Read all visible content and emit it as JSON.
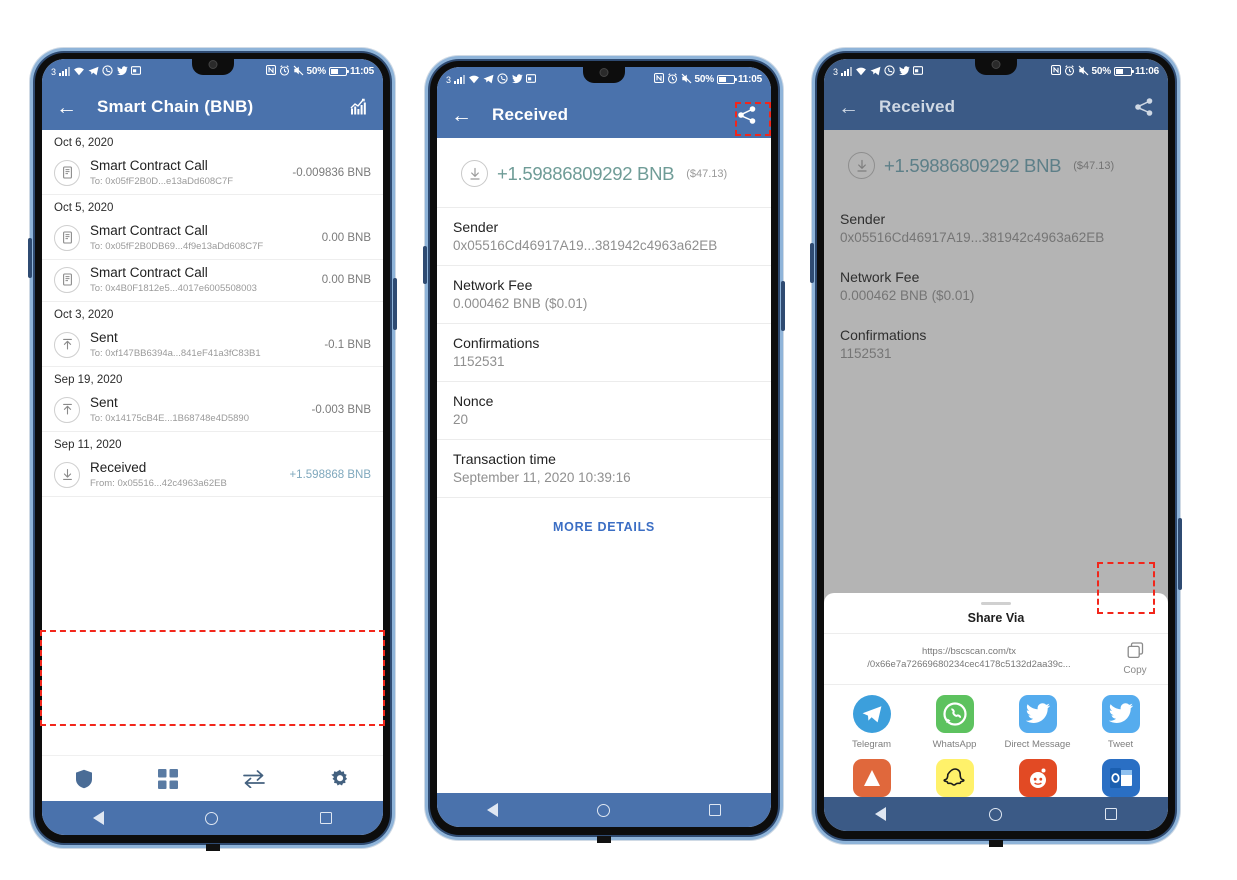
{
  "meta": {
    "phone1_label": "transaction-history-screen",
    "phone2_label": "transaction-detail-screen",
    "phone3_label": "share-sheet-screen"
  },
  "colors": {
    "app_bar_blue": "#4a72ac",
    "app_bar_blue_dim": "#3b5a86",
    "accent_link": "#3b6ec4",
    "amount_green": "#6f9c97",
    "amount_blue_grey": "#7fa8bd",
    "highlight_red": "#f2261b",
    "telegram": "#3c9fdc",
    "whatsapp": "#5dc25f",
    "twitter": "#55acee"
  },
  "status_bar": {
    "left_number": "3",
    "left_icons": [
      "signal-bars-icon",
      "wifi-icon",
      "telegram-icon",
      "whatsapp-icon",
      "twitter-icon",
      "mail-icon"
    ],
    "right_icons": [
      "nfc-icon",
      "alarm-icon",
      "mute-icon"
    ],
    "battery_percent": "50%",
    "time_phone1": "11:05",
    "time_phone2": "11:05",
    "time_phone3": "11:06"
  },
  "phone1": {
    "app_bar": {
      "back_icon": "arrow-left-icon",
      "title": "Smart Chain (BNB)",
      "right_icon": "chart-icon"
    },
    "groups": [
      {
        "date": "Oct 6, 2020",
        "items": [
          {
            "icon": "contract-icon",
            "title": "Smart Contract Call",
            "sub": "To: 0x05fF2B0D...e13aDd608C7F",
            "amount": "-0.009836 BNB",
            "positive": false
          }
        ]
      },
      {
        "date": "Oct 5, 2020",
        "items": [
          {
            "icon": "contract-icon",
            "title": "Smart Contract Call",
            "sub": "To: 0x05fF2B0DB69...4f9e13aDd608C7F",
            "amount": "0.00 BNB",
            "positive": false
          },
          {
            "icon": "contract-icon",
            "title": "Smart Contract Call",
            "sub": "To: 0x4B0F1812e5...4017e6005508003",
            "amount": "0.00 BNB",
            "positive": false
          }
        ]
      },
      {
        "date": "Oct 3, 2020",
        "items": [
          {
            "icon": "sent-up-icon",
            "title": "Sent",
            "sub": "To: 0xf147BB6394a...841eF41a3fC83B1",
            "amount": "-0.1 BNB",
            "positive": false
          }
        ]
      },
      {
        "date": "Sep 19, 2020",
        "items": [
          {
            "icon": "sent-up-icon",
            "title": "Sent",
            "sub": "To: 0x14175cB4E...1B68748e4D5890",
            "amount": "-0.003 BNB",
            "positive": false
          }
        ]
      },
      {
        "date": "Sep 11, 2020",
        "items": [
          {
            "icon": "received-down-icon",
            "title": "Received",
            "sub": "From: 0x05516...42c4963a62EB",
            "amount": "+1.598868 BNB",
            "positive": true
          }
        ]
      }
    ],
    "bottom_nav": [
      {
        "icon": "shield-icon",
        "name": "wallet-tab"
      },
      {
        "icon": "grid-icon",
        "name": "apps-tab"
      },
      {
        "icon": "swap-icon",
        "name": "swap-tab"
      },
      {
        "icon": "gear-icon",
        "name": "settings-tab"
      }
    ]
  },
  "phone2": {
    "app_bar": {
      "back_icon": "arrow-left-icon",
      "title": "Received",
      "right_icon": "share-icon"
    },
    "hero": {
      "icon": "received-down-icon",
      "amount": "+1.59886809292 BNB",
      "fiat": "($47.13)"
    },
    "details": [
      {
        "label": "Sender",
        "value": "0x05516Cd46917A19...381942c4963a62EB"
      },
      {
        "label": "Network Fee",
        "value": "0.000462 BNB ($0.01)"
      },
      {
        "label": "Confirmations",
        "value": "1152531"
      },
      {
        "label": "Nonce",
        "value": "20"
      },
      {
        "label": "Transaction time",
        "value": "September 11, 2020 10:39:16"
      }
    ],
    "more_details": "MORE DETAILS"
  },
  "phone3": {
    "app_bar": {
      "back_icon": "arrow-left-icon",
      "title": "Received",
      "right_icon": "share-icon"
    },
    "hero": {
      "icon": "received-down-icon",
      "amount": "+1.59886809292 BNB",
      "fiat": "($47.13)"
    },
    "details": [
      {
        "label": "Sender",
        "value": "0x05516Cd46917A19...381942c4963a62EB"
      },
      {
        "label": "Network Fee",
        "value": "0.000462 BNB ($0.01)"
      },
      {
        "label": "Confirmations",
        "value": "1152531"
      }
    ],
    "share_sheet": {
      "title": "Share Via",
      "url_line1": "https://bscscan.com/tx",
      "url_line2": "/0x66e7a72669680234cec4178c5132d2aa39c...",
      "copy_icon": "copy-icon",
      "copy_label": "Copy",
      "apps_row1": [
        {
          "icon": "telegram-icon",
          "label": "Telegram",
          "color": "#3c9fdc",
          "shape": "circle"
        },
        {
          "icon": "whatsapp-icon",
          "label": "WhatsApp",
          "color": "#5dc25f",
          "shape": "rounded"
        },
        {
          "icon": "twitter-dm-icon",
          "label": "Direct Message",
          "color": "#55acee",
          "shape": "rounded"
        },
        {
          "icon": "twitter-tweet-icon",
          "label": "Tweet",
          "color": "#55acee",
          "shape": "rounded"
        }
      ],
      "apps_row2": [
        {
          "icon": "app-orange-icon",
          "label": "",
          "color": "#e0683c",
          "shape": "rounded"
        },
        {
          "icon": "snapchat-icon",
          "label": "",
          "color": "#fff16a",
          "shape": "rounded"
        },
        {
          "icon": "reddit-icon",
          "label": "",
          "color": "#e24a24",
          "shape": "rounded"
        },
        {
          "icon": "outlook-icon",
          "label": "",
          "color": "#2a6fc4",
          "shape": "rounded"
        }
      ]
    }
  }
}
